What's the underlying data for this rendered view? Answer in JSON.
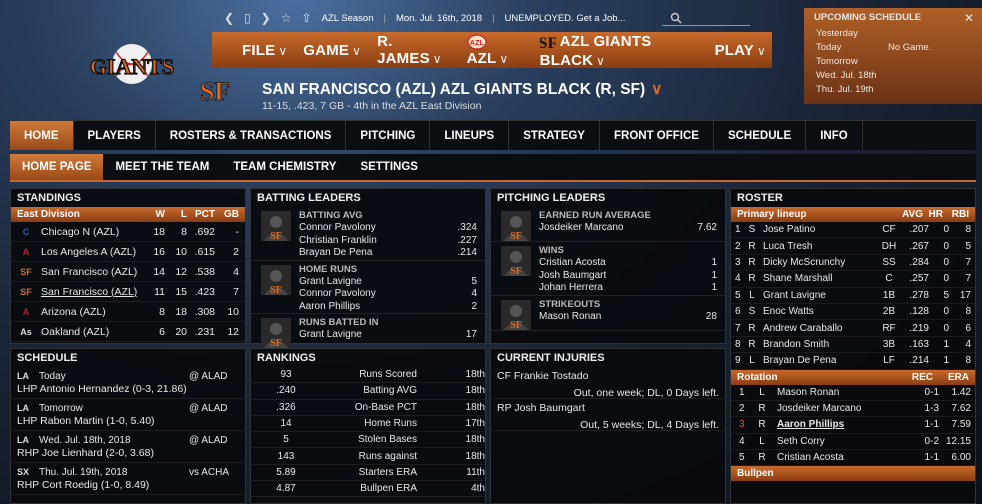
{
  "util": {
    "season": "AZL Season",
    "date": "Mon. Jul. 16th, 2018",
    "status": "UNEMPLOYED. Get a Job..."
  },
  "nav": {
    "file": "FILE",
    "game": "GAME",
    "manager": "R. JAMES",
    "league": "AZL",
    "team": "AZL GIANTS BLACK",
    "play": "PLAY"
  },
  "team": {
    "title": "SAN FRANCISCO (AZL) AZL GIANTS BLACK (R, SF)",
    "subtitle": "11-15, .423, 7 GB - 4th in the AZL East Division"
  },
  "upcoming": {
    "header": "UPCOMING SCHEDULE",
    "rows": [
      {
        "day": "Yesterday",
        "game": ""
      },
      {
        "day": "Today",
        "game": "No Game."
      },
      {
        "day": "Tomorrow",
        "game": ""
      },
      {
        "day": "Wed. Jul. 18th",
        "game": ""
      },
      {
        "day": "Thu. Jul. 19th",
        "game": ""
      }
    ]
  },
  "tabs": [
    "HOME",
    "PLAYERS",
    "ROSTERS & TRANSACTIONS",
    "PITCHING",
    "LINEUPS",
    "STRATEGY",
    "FRONT OFFICE",
    "SCHEDULE",
    "INFO"
  ],
  "subtabs": [
    "HOME PAGE",
    "MEET THE TEAM",
    "TEAM CHEMISTRY",
    "SETTINGS"
  ],
  "standings": {
    "title": "STANDINGS",
    "division": "East Division",
    "cols": [
      "W",
      "L",
      "PCT",
      "GB"
    ],
    "rows": [
      {
        "team": "Chicago N (AZL)",
        "w": "18",
        "l": "8",
        "pct": ".692",
        "gb": "-",
        "logo": "C",
        "color": "#2a5ab0"
      },
      {
        "team": "Los Angeles A (AZL)",
        "w": "16",
        "l": "10",
        "pct": ".615",
        "gb": "2",
        "logo": "A",
        "color": "#c8202a"
      },
      {
        "team": "San Francisco (AZL)",
        "w": "14",
        "l": "12",
        "pct": ".538",
        "gb": "4",
        "logo": "SF",
        "color": "#e06a20"
      },
      {
        "team": "San Francisco (AZL)",
        "w": "11",
        "l": "15",
        "pct": ".423",
        "gb": "7",
        "logo": "SF",
        "color": "#e06a20"
      },
      {
        "team": "Arizona (AZL)",
        "w": "8",
        "l": "18",
        "pct": ".308",
        "gb": "10",
        "logo": "A",
        "color": "#a8202a"
      },
      {
        "team": "Oakland (AZL)",
        "w": "6",
        "l": "20",
        "pct": ".231",
        "gb": "12",
        "logo": "As",
        "color": "#dddddd"
      }
    ]
  },
  "batting": {
    "title": "BATTING LEADERS",
    "groups": [
      {
        "cat": "BATTING AVG",
        "rows": [
          {
            "n": "Connor Pavolony",
            "v": ".324"
          },
          {
            "n": "Christian Franklin",
            "v": ".227"
          },
          {
            "n": "Brayan De Pena",
            "v": ".214"
          }
        ]
      },
      {
        "cat": "HOME RUNS",
        "rows": [
          {
            "n": "Grant Lavigne",
            "v": "5"
          },
          {
            "n": "Connor Pavolony",
            "v": "4"
          },
          {
            "n": "Aaron Phillips",
            "v": "2"
          }
        ]
      },
      {
        "cat": "RUNS BATTED IN",
        "rows": [
          {
            "n": "Grant Lavigne",
            "v": "17"
          }
        ]
      }
    ]
  },
  "pitching": {
    "title": "PITCHING LEADERS",
    "groups": [
      {
        "cat": "EARNED RUN AVERAGE",
        "rows": [
          {
            "n": "Josdeiker Marcano",
            "v": "7.62"
          }
        ]
      },
      {
        "cat": "WINS",
        "rows": [
          {
            "n": "Cristian Acosta",
            "v": "1"
          },
          {
            "n": "Josh Baumgart",
            "v": "1"
          },
          {
            "n": "Johan Herrera",
            "v": "1"
          }
        ]
      },
      {
        "cat": "STRIKEOUTS",
        "rows": [
          {
            "n": "Mason Ronan",
            "v": "28"
          }
        ]
      }
    ]
  },
  "roster": {
    "title": "ROSTER",
    "lineup_label": "Primary lineup",
    "cols": [
      "AVG",
      "HR",
      "RBI"
    ],
    "lineup": [
      {
        "n": "1",
        "h": "S",
        "name": "Jose Patino",
        "pos": "CF",
        "avg": ".207",
        "hr": "0",
        "rbi": "8"
      },
      {
        "n": "2",
        "h": "R",
        "name": "Luca Tresh",
        "pos": "DH",
        "avg": ".267",
        "hr": "0",
        "rbi": "5"
      },
      {
        "n": "3",
        "h": "R",
        "name": "Dicky McScrunchy",
        "pos": "SS",
        "avg": ".284",
        "hr": "0",
        "rbi": "7"
      },
      {
        "n": "4",
        "h": "R",
        "name": "Shane Marshall",
        "pos": "C",
        "avg": ".257",
        "hr": "0",
        "rbi": "7"
      },
      {
        "n": "5",
        "h": "L",
        "name": "Grant Lavigne",
        "pos": "1B",
        "avg": ".278",
        "hr": "5",
        "rbi": "17"
      },
      {
        "n": "6",
        "h": "S",
        "name": "Enoc Watts",
        "pos": "2B",
        "avg": ".128",
        "hr": "0",
        "rbi": "8"
      },
      {
        "n": "7",
        "h": "R",
        "name": "Andrew Caraballo",
        "pos": "RF",
        "avg": ".219",
        "hr": "0",
        "rbi": "6"
      },
      {
        "n": "8",
        "h": "R",
        "name": "Brandon Smith",
        "pos": "3B",
        "avg": ".163",
        "hr": "1",
        "rbi": "4"
      },
      {
        "n": "9",
        "h": "L",
        "name": "Brayan De Pena",
        "pos": "LF",
        "avg": ".214",
        "hr": "1",
        "rbi": "8"
      }
    ],
    "rotation_label": "Rotation",
    "rot_cols": [
      "REC",
      "ERA"
    ],
    "rotation": [
      {
        "n": "1",
        "h": "L",
        "name": "Mason Ronan",
        "rec": "0-1",
        "era": "1.42"
      },
      {
        "n": "2",
        "h": "R",
        "name": "Josdeiker Marcano",
        "rec": "1-3",
        "era": "7.62"
      },
      {
        "n": "3",
        "h": "R",
        "name": "Aaron Phillips",
        "rec": "1-1",
        "era": "7.59"
      },
      {
        "n": "4",
        "h": "L",
        "name": "Seth Corry",
        "rec": "0-2",
        "era": "12.15"
      },
      {
        "n": "5",
        "h": "R",
        "name": "Cristian Acosta",
        "rec": "1-1",
        "era": "6.00"
      }
    ],
    "bullpen_label": "Bullpen"
  },
  "schedule": {
    "title": "SCHEDULE",
    "rows": [
      {
        "day": "Today",
        "opp": "@ ALAD",
        "pitcher": "LHP Antonio Hernandez (0-3, 21.86)",
        "logo": "LA"
      },
      {
        "day": "Tomorrow",
        "opp": "@ ALAD",
        "pitcher": "LHP Rabon Martin (1-0, 5.40)",
        "logo": "LA"
      },
      {
        "day": "Wed. Jul. 18th, 2018",
        "opp": "@ ALAD",
        "pitcher": "RHP Joe Lienhard (2-0, 3.68)",
        "logo": "LA"
      },
      {
        "day": "Thu. Jul. 19th, 2018",
        "opp": "vs ACHA",
        "pitcher": "RHP Cort Roedig (1-0, 8.49)",
        "logo": "SX"
      }
    ]
  },
  "rankings": {
    "title": "RANKINGS",
    "rows": [
      {
        "v": "93",
        "cat": "Runs Scored",
        "rank": "18th"
      },
      {
        "v": ".240",
        "cat": "Batting AVG",
        "rank": "18th"
      },
      {
        "v": ".326",
        "cat": "On-Base PCT",
        "rank": "18th"
      },
      {
        "v": "14",
        "cat": "Home Runs",
        "rank": "17th"
      },
      {
        "v": "5",
        "cat": "Stolen Bases",
        "rank": "18th"
      },
      {
        "v": "143",
        "cat": "Runs against",
        "rank": "18th"
      },
      {
        "v": "5.89",
        "cat": "Starters ERA",
        "rank": "11th"
      },
      {
        "v": "4.87",
        "cat": "Bullpen ERA",
        "rank": "4th"
      }
    ]
  },
  "injuries": {
    "title": "CURRENT INJURIES",
    "rows": [
      {
        "player": "CF Frankie Tostado",
        "status": "Out, one week; DL, 0 Days left."
      },
      {
        "player": "RP Josh Baumgart",
        "status": "Out, 5 weeks; DL, 4 Days left."
      }
    ]
  },
  "colors": {
    "accent": "#c8692b",
    "highlight": "#e0502a"
  }
}
